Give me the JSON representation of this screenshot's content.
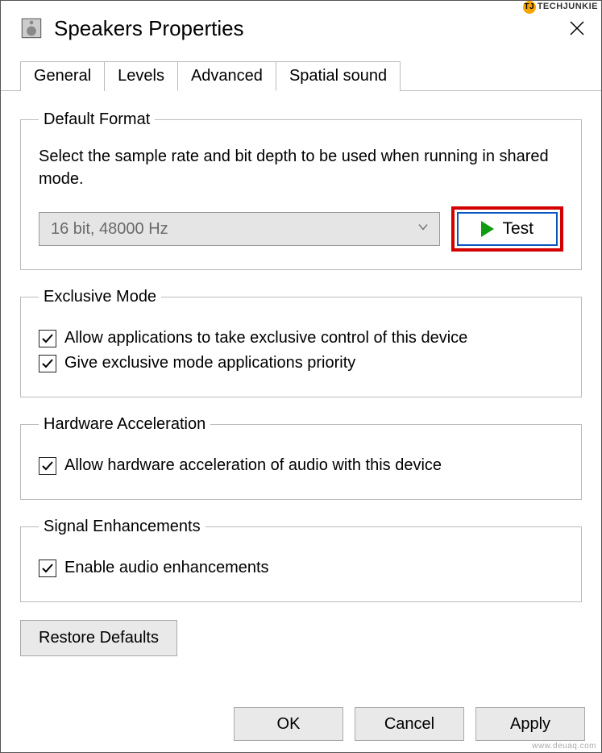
{
  "watermarks": {
    "top": "TECHJUNKIE",
    "bottom": "www.deuaq.com"
  },
  "window": {
    "title": "Speakers Properties"
  },
  "tabs": [
    {
      "label": "General",
      "active": false
    },
    {
      "label": "Levels",
      "active": false
    },
    {
      "label": "Advanced",
      "active": true
    },
    {
      "label": "Spatial sound",
      "active": false
    }
  ],
  "default_format": {
    "legend": "Default Format",
    "description": "Select the sample rate and bit depth to be used when running in shared mode.",
    "selected": "16 bit, 48000 Hz",
    "test_label": "Test"
  },
  "exclusive_mode": {
    "legend": "Exclusive Mode",
    "options": [
      {
        "label": "Allow applications to take exclusive control of this device",
        "checked": true
      },
      {
        "label": "Give exclusive mode applications priority",
        "checked": true
      }
    ]
  },
  "hardware_accel": {
    "legend": "Hardware Acceleration",
    "options": [
      {
        "label": "Allow hardware acceleration of audio with this device",
        "checked": true
      }
    ]
  },
  "signal_enh": {
    "legend": "Signal Enhancements",
    "options": [
      {
        "label": "Enable audio enhancements",
        "checked": true
      }
    ]
  },
  "restore_defaults": "Restore Defaults",
  "buttons": {
    "ok": "OK",
    "cancel": "Cancel",
    "apply": "Apply"
  }
}
